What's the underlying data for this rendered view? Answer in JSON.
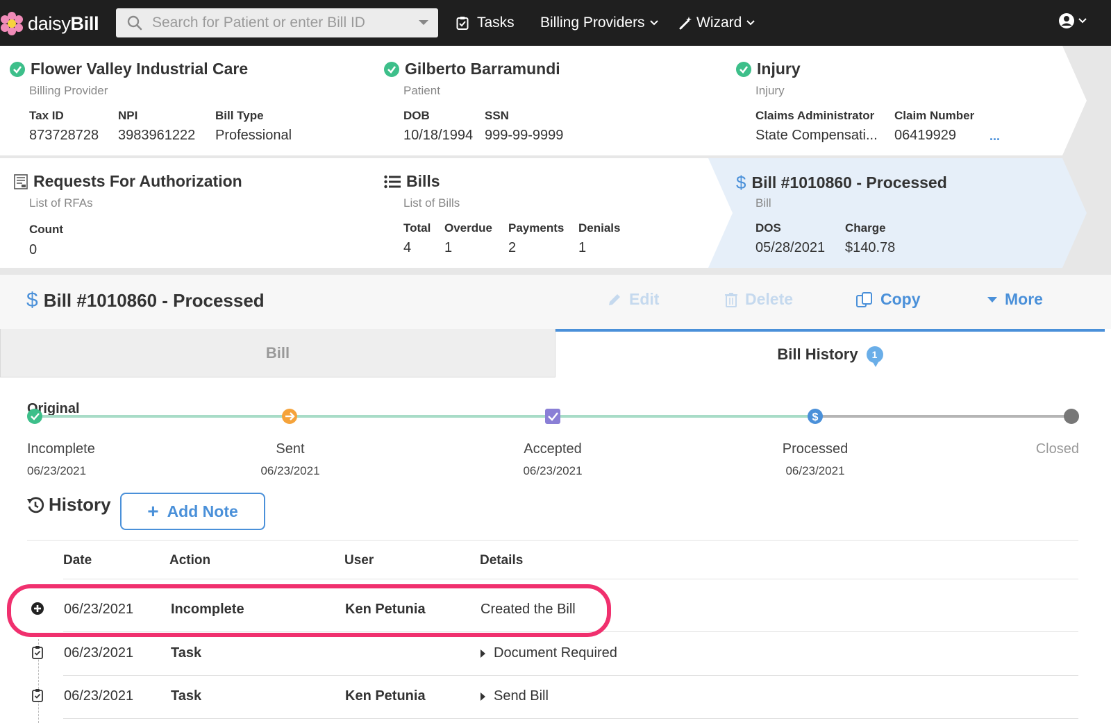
{
  "topnav": {
    "brand_light": "daisy",
    "brand_bold": "Bill",
    "search_placeholder": "Search for Patient or enter Bill ID",
    "tasks": "Tasks",
    "billing_providers": "Billing Providers",
    "wizard": "Wizard"
  },
  "cards": {
    "provider": {
      "title": "Flower Valley Industrial Care",
      "subtitle": "Billing Provider",
      "labels": [
        "Tax ID",
        "NPI",
        "Bill Type"
      ],
      "values": [
        "873728728",
        "3983961222",
        "Professional"
      ]
    },
    "patient": {
      "title": "Gilberto Barramundi",
      "subtitle": "Patient",
      "labels": [
        "DOB",
        "SSN"
      ],
      "values": [
        "10/18/1994",
        "999-99-9999"
      ]
    },
    "injury": {
      "title": "Injury",
      "subtitle": "Injury",
      "labels": [
        "Claims Administrator",
        "Claim Number"
      ],
      "values": [
        "State Compensati...",
        "06419929"
      ],
      "more": "..."
    },
    "rfa": {
      "title": "Requests For Authorization",
      "subtitle": "List of RFAs",
      "labels": [
        "Count"
      ],
      "values": [
        "0"
      ]
    },
    "bills": {
      "title": "Bills",
      "subtitle": "List of Bills",
      "labels": [
        "Total",
        "Overdue",
        "Payments",
        "Denials"
      ],
      "values": [
        "4",
        "1",
        "2",
        "1"
      ]
    },
    "bill": {
      "title": "Bill #1010860 - Processed",
      "subtitle": "Bill",
      "labels": [
        "DOS",
        "Charge"
      ],
      "values": [
        "05/28/2021",
        "$140.78"
      ]
    }
  },
  "panel": {
    "title": "Bill #1010860 - Processed",
    "actions": {
      "edit": "Edit",
      "delete": "Delete",
      "copy": "Copy",
      "more": "More"
    },
    "tabs": {
      "bill": "Bill",
      "history": "Bill History",
      "history_badge": "1"
    },
    "timeline_label": "Original",
    "steps": [
      {
        "name": "Incomplete",
        "date": "06/23/2021"
      },
      {
        "name": "Sent",
        "date": "06/23/2021"
      },
      {
        "name": "Accepted",
        "date": "06/23/2021"
      },
      {
        "name": "Processed",
        "date": "06/23/2021"
      },
      {
        "name": "Closed",
        "date": ""
      }
    ],
    "history_title": "History",
    "add_note": "Add Note",
    "columns": [
      "Date",
      "Action",
      "User",
      "Details"
    ],
    "rows": [
      {
        "date": "06/23/2021",
        "action": "Incomplete",
        "user": "Ken Petunia",
        "details": "Created the Bill",
        "icon": "plus-circle-icon"
      },
      {
        "date": "06/23/2021",
        "action": "Task",
        "user": "",
        "details": "Document Required",
        "icon": "clipboard-check-icon"
      },
      {
        "date": "06/23/2021",
        "action": "Task",
        "user": "Ken Petunia",
        "details": "Send Bill",
        "icon": "clipboard-check-icon"
      }
    ]
  },
  "colors": {
    "accent": "#4a90d9",
    "success": "#3dbf8a",
    "sent": "#f5a33b",
    "accepted": "#8a7fd6",
    "highlight": "#f0306e",
    "nav_bg": "#1f1f1f"
  }
}
